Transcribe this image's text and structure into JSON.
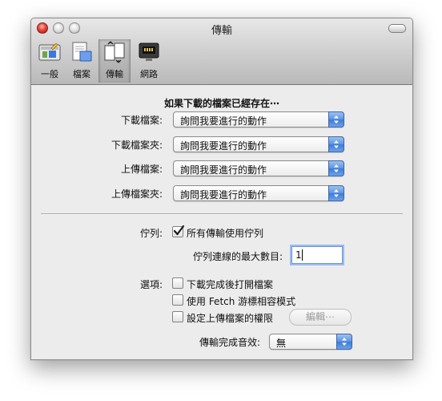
{
  "window": {
    "title": "傳輸"
  },
  "toolbar": {
    "items": [
      {
        "label": "一般",
        "icon": "general-prefs-icon"
      },
      {
        "label": "檔案",
        "icon": "files-icon"
      },
      {
        "label": "傳輸",
        "icon": "transfer-icon",
        "selected": true
      },
      {
        "label": "網路",
        "icon": "network-icon"
      }
    ]
  },
  "existing": {
    "header": "如果下載的檔案已經存在⋯",
    "rows": [
      {
        "label": "下載檔案:",
        "value": "詢問我要進行的動作"
      },
      {
        "label": "下載檔案夾:",
        "value": "詢問我要進行的動作"
      },
      {
        "label": "上傳檔案:",
        "value": "詢問我要進行的動作"
      },
      {
        "label": "上傳檔案夾:",
        "value": "詢問我要進行的動作"
      }
    ]
  },
  "queue": {
    "label": "佇列:",
    "checkbox_label": "所有傳輸使用佇列",
    "checked": true,
    "max_label": "佇列連線的最大數目:",
    "max_value": "1"
  },
  "options": {
    "label": "選項:",
    "items": [
      {
        "label": "下載完成後打開檔案",
        "checked": false
      },
      {
        "label": "使用 Fetch 游標相容模式",
        "checked": false
      },
      {
        "label": "設定上傳檔案的權限",
        "checked": false
      }
    ],
    "edit_button": "編輯⋯"
  },
  "sound": {
    "label": "傳輸完成音效:",
    "value": "無"
  },
  "colors": {
    "accent": "#3e7ad6",
    "window_bg": "#ececec"
  }
}
